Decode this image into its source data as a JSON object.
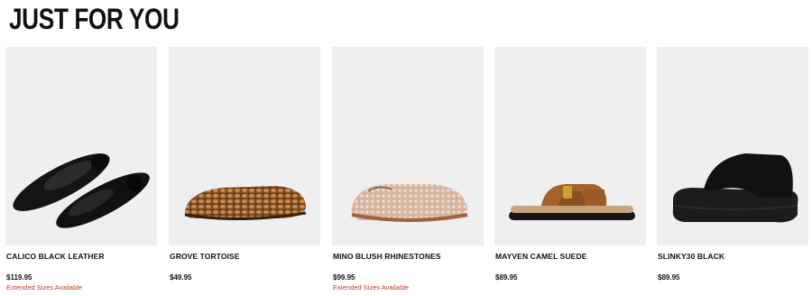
{
  "section": {
    "title": "JUST FOR YOU"
  },
  "products": [
    {
      "name": "CALICO BLACK LEATHER",
      "price": "$119.95",
      "note": "Extended Sizes Available",
      "image_icon": "black-leather-ballet-flats"
    },
    {
      "name": "GROVE TORTOISE",
      "price": "$49.95",
      "note": "",
      "image_icon": "woven-tortoise-flat"
    },
    {
      "name": "MINO BLUSH RHINESTONES",
      "price": "$99.95",
      "note": "Extended Sizes Available",
      "image_icon": "mesh-rhinestone-flat"
    },
    {
      "name": "MAYVEN CAMEL SUEDE",
      "price": "$89.95",
      "note": "",
      "image_icon": "camel-suede-sandal"
    },
    {
      "name": "SLINKY30 BLACK",
      "price": "$89.95",
      "note": "",
      "image_icon": "black-platform-slide"
    }
  ],
  "colors": {
    "note_red": "#c0392b",
    "tile_bg": "#efefef",
    "text": "#111111"
  }
}
